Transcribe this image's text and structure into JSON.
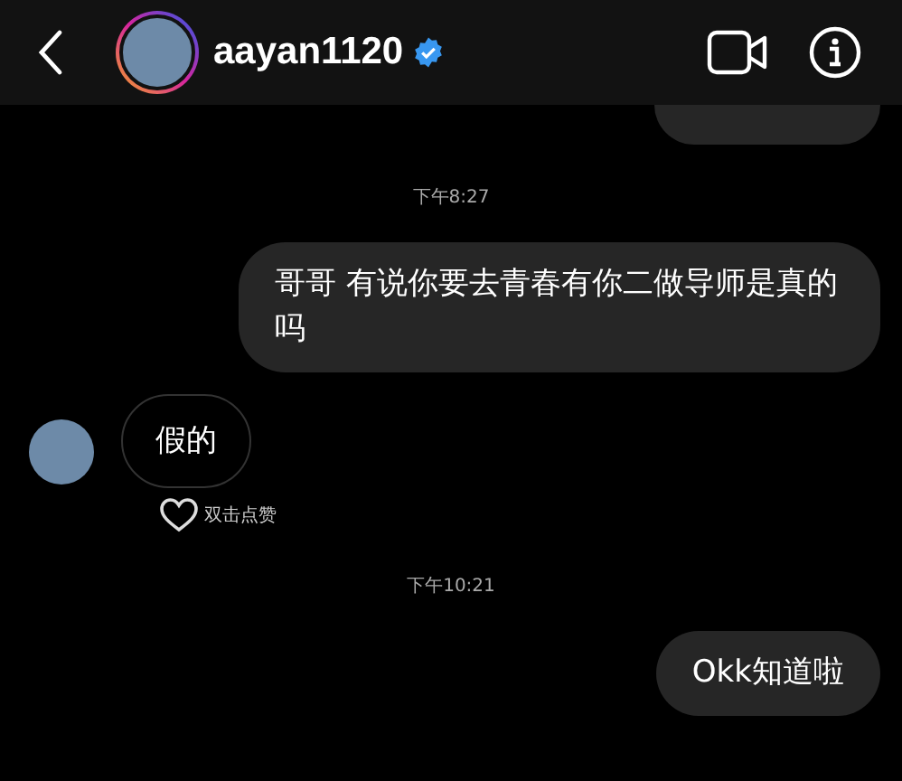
{
  "header": {
    "username": "aayan1120",
    "verified": true
  },
  "messages": [
    {
      "kind": "partial"
    },
    {
      "kind": "time",
      "text": "下午8:27"
    },
    {
      "kind": "sent",
      "text": "哥哥 有说你要去青春有你二做导师是真的吗"
    },
    {
      "kind": "received",
      "text": "假的"
    },
    {
      "kind": "like_hint",
      "text": "双击点赞"
    },
    {
      "kind": "time",
      "text": "下午10:21"
    },
    {
      "kind": "sent",
      "text": "Okk知道啦"
    }
  ]
}
